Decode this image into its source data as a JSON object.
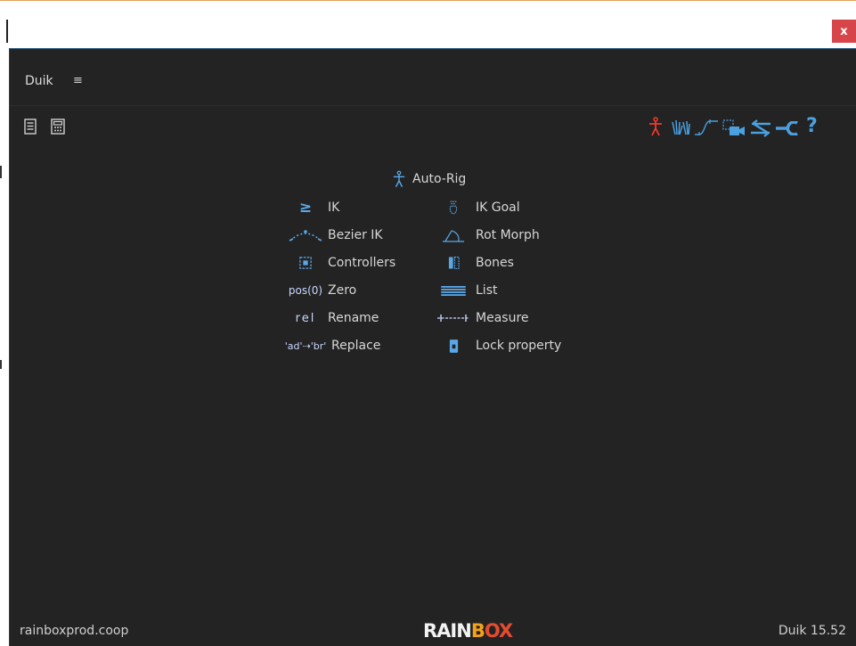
{
  "window": {
    "close_label": "x"
  },
  "panel": {
    "title": "Duik",
    "menu_icon": "≡"
  },
  "toolbar_left": [
    {
      "icon": "notes-icon"
    },
    {
      "icon": "calculator-icon"
    }
  ],
  "toolbar_right": [
    {
      "icon": "autorig-figure-icon",
      "color": "#ff3b30"
    },
    {
      "icon": "hands-icon",
      "color": "#4ba0e0"
    },
    {
      "icon": "curve-icon",
      "color": "#4ba0e0"
    },
    {
      "icon": "camera-icon",
      "color": "#4ba0e0"
    },
    {
      "icon": "link-icon",
      "color": "#4ba0e0"
    },
    {
      "icon": "wrench-icon",
      "color": "#4ba0e0"
    },
    {
      "icon": "help-icon",
      "glyph": "?",
      "color": "#4ba0e0"
    }
  ],
  "main": {
    "auto_rig": "Auto-Rig",
    "items_left": [
      {
        "label": "IK",
        "icon": "ik-icon",
        "glyph": "≥"
      },
      {
        "label": "Bezier IK",
        "icon": "bezier-ik-icon",
        "glyph": "⋰⋱"
      },
      {
        "label": "Controllers",
        "icon": "controllers-icon",
        "glyph": "⛶"
      },
      {
        "label": "Zero",
        "icon": "zero-icon",
        "glyph": "pos(0)"
      },
      {
        "label": "Rename",
        "icon": "rename-icon",
        "glyph": "rel"
      },
      {
        "label": "Replace",
        "icon": "replace-icon",
        "glyph": "'ad'⇢'br'"
      }
    ],
    "items_right": [
      {
        "label": "IK Goal",
        "icon": "ik-goal-icon",
        "glyph": "☋"
      },
      {
        "label": "Rot Morph",
        "icon": "rot-morph-icon",
        "glyph": "◭"
      },
      {
        "label": "Bones",
        "icon": "bones-icon",
        "glyph": "▮▯"
      },
      {
        "label": "List",
        "icon": "list-icon",
        "glyph": "☰"
      },
      {
        "label": "Measure",
        "icon": "measure-icon",
        "glyph": "⊣⊢"
      },
      {
        "label": "Lock property",
        "icon": "lock-icon",
        "glyph": "🔒"
      }
    ]
  },
  "footer": {
    "website": "rainboxprod.coop",
    "brand_white": "RAIN",
    "brand_orange": "B",
    "brand_red": "OX",
    "version": "Duik 15.52"
  }
}
